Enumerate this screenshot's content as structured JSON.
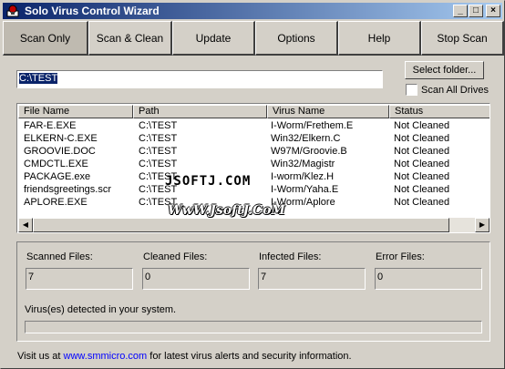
{
  "window": {
    "title": "Solo Virus Control Wizard",
    "controls": {
      "minimize": "_",
      "maximize": "□",
      "close": "×"
    }
  },
  "toolbar": {
    "buttons": [
      {
        "label": "Scan Only"
      },
      {
        "label": "Scan & Clean"
      },
      {
        "label": "Update"
      },
      {
        "label": "Options"
      },
      {
        "label": "Help"
      },
      {
        "label": "Stop Scan"
      }
    ]
  },
  "path": {
    "value": "C:\\TEST"
  },
  "select_folder": {
    "label": "Select folder..."
  },
  "scan_all_drives": {
    "label": "Scan All Drives",
    "checked": false
  },
  "results": {
    "columns": [
      "File Name",
      "Path",
      "Virus Name",
      "Status"
    ],
    "rows": [
      [
        "FAR-E.EXE",
        "C:\\TEST",
        "I-Worm/Frethem.E",
        "Not Cleaned"
      ],
      [
        "ELKERN-C.EXE",
        "C:\\TEST",
        "Win32/Elkern.C",
        "Not Cleaned"
      ],
      [
        "GROOVIE.DOC",
        "C:\\TEST",
        "W97M/Groovie.B",
        "Not Cleaned"
      ],
      [
        "CMDCTL.EXE",
        "C:\\TEST",
        "Win32/Magistr",
        "Not Cleaned"
      ],
      [
        "PACKAGE.exe",
        "C:\\TEST",
        "I-worm/Klez.H",
        "Not Cleaned"
      ],
      [
        "friendsgreetings.scr",
        "C:\\TEST",
        "I-Worm/Yaha.E",
        "Not Cleaned"
      ],
      [
        "APLORE.EXE",
        "C:\\TEST",
        "I-Worm/Aplore",
        "Not Cleaned"
      ]
    ]
  },
  "stats": {
    "scanned": {
      "label": "Scanned Files:",
      "value": "7"
    },
    "cleaned": {
      "label": "Cleaned Files:",
      "value": "0"
    },
    "infected": {
      "label": "Infected Files:",
      "value": "7"
    },
    "errors": {
      "label": "Error Files:",
      "value": "0"
    }
  },
  "status_message": "Virus(es) detected in your system.",
  "progress": 0,
  "footer": {
    "prefix": "Visit us at ",
    "link": "www.smmicro.com",
    "suffix": " for latest virus alerts and security information."
  },
  "watermark": {
    "line1": "JSOFTJ.COM",
    "line2": "WwW.JsoftJ.CoM"
  },
  "colors": {
    "title_bar": "#0a246a",
    "selection": "#0a246a",
    "link": "#0000ff",
    "face": "#d4d0c8"
  }
}
